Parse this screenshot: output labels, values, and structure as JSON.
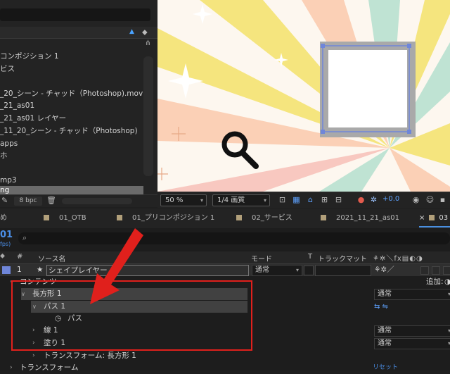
{
  "project": {
    "items": [
      {
        "label": "コンポジション 1"
      },
      {
        "label": "ビス"
      },
      {
        "label": ""
      },
      {
        "label": "_20_シーン - チャッド（Photoshop).mov"
      },
      {
        "label": "_21_as01"
      },
      {
        "label": "_21_as01 レイヤー"
      },
      {
        "label": "_11_20_シーン - チャッド（Photoshop)"
      },
      {
        "label": "apps"
      },
      {
        "label": "ホ"
      },
      {
        "label": ""
      },
      {
        "label": "mp3"
      },
      {
        "label": "ng"
      }
    ],
    "bpc": "8 bpc"
  },
  "viewer": {
    "zoom": "50 %",
    "resolution": "1/4 画質",
    "exposure": "+0.0"
  },
  "tabs": [
    {
      "label": "め"
    },
    {
      "label": "01_OTB"
    },
    {
      "label": "01_プリコンポジション 1"
    },
    {
      "label": "02_サービス"
    },
    {
      "label": "2021_11_21_as01"
    },
    {
      "label": "03"
    }
  ],
  "timeline": {
    "time": "01",
    "fps": "fps)",
    "search_placeholder": "",
    "headers": {
      "num": "#",
      "source": "ソース名",
      "mode": "モード",
      "t": "T",
      "trackmatte": "トラックマット"
    },
    "layer": {
      "num": "1",
      "name": "シェイプレイヤー",
      "mode": "通常"
    },
    "contents_label": "コンテンツ",
    "add_label": "追加:",
    "rows": [
      {
        "label": "長方形 1",
        "mode": "通常"
      },
      {
        "label": "パス 1"
      },
      {
        "label": "パス"
      },
      {
        "label": "線 1",
        "mode": "通常"
      },
      {
        "label": "塗り 1",
        "mode": "通常"
      },
      {
        "label": "トランスフォーム: 長方形 1"
      },
      {
        "label": "トランスフォーム"
      }
    ],
    "reset_label": "リセット"
  },
  "colors": {
    "accent": "#e0201c",
    "layer_label": "#6f86d9",
    "tab_swatch": "#b19f7a"
  }
}
